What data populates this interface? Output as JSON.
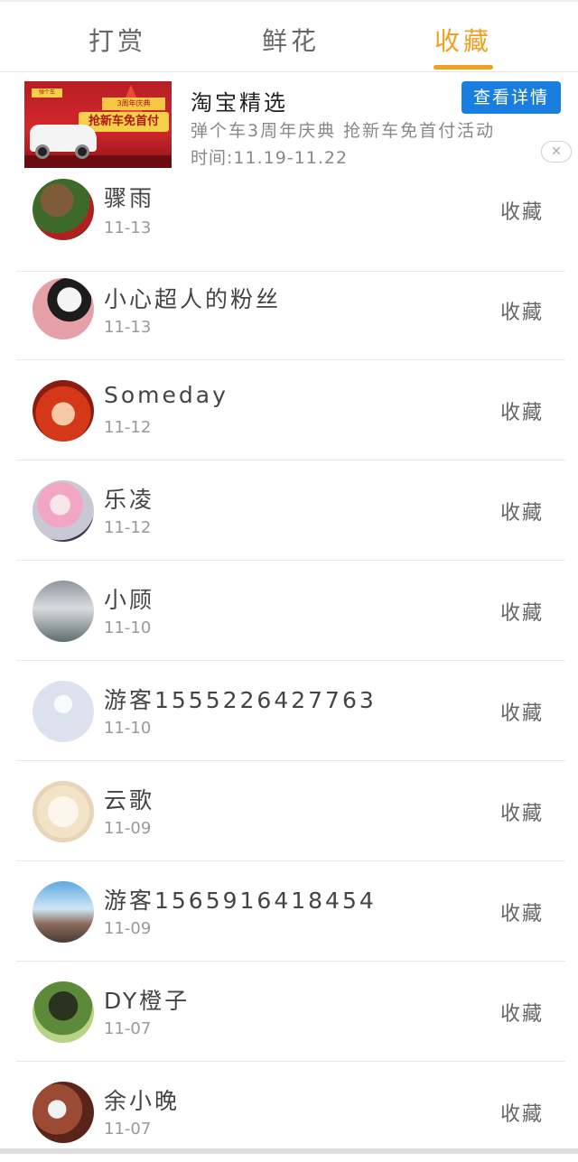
{
  "tabs": [
    {
      "label": "打赏",
      "active": false
    },
    {
      "label": "鲜花",
      "active": false
    },
    {
      "label": "收藏",
      "active": true
    }
  ],
  "accent_color": "#f0a020",
  "ad": {
    "title": "淘宝精选",
    "button_label": "查看详情",
    "description": "弹个车3周年庆典 抢新车免首付活动",
    "time": "时间:11.19-11.22",
    "image": {
      "badge": "3周年庆典",
      "banner": "抢新车免首付",
      "logo": "弹个车"
    },
    "close_icon": "close-icon"
  },
  "list": [
    {
      "name": "骤雨",
      "date": "11-13",
      "action": "收藏"
    },
    {
      "name": "小心超人的粉丝",
      "date": "11-13",
      "action": "收藏"
    },
    {
      "name": "Someday",
      "date": "11-12",
      "action": "收藏"
    },
    {
      "name": "乐凌",
      "date": "11-12",
      "action": "收藏"
    },
    {
      "name": "小顾",
      "date": "11-10",
      "action": "收藏"
    },
    {
      "name": "游客1555226427763",
      "date": "11-10",
      "action": "收藏"
    },
    {
      "name": "云歌",
      "date": "11-09",
      "action": "收藏"
    },
    {
      "name": "游客1565916418454",
      "date": "11-09",
      "action": "收藏"
    },
    {
      "name": "DY橙子",
      "date": "11-07",
      "action": "收藏"
    },
    {
      "name": "余小晚",
      "date": "11-07",
      "action": "收藏"
    }
  ]
}
